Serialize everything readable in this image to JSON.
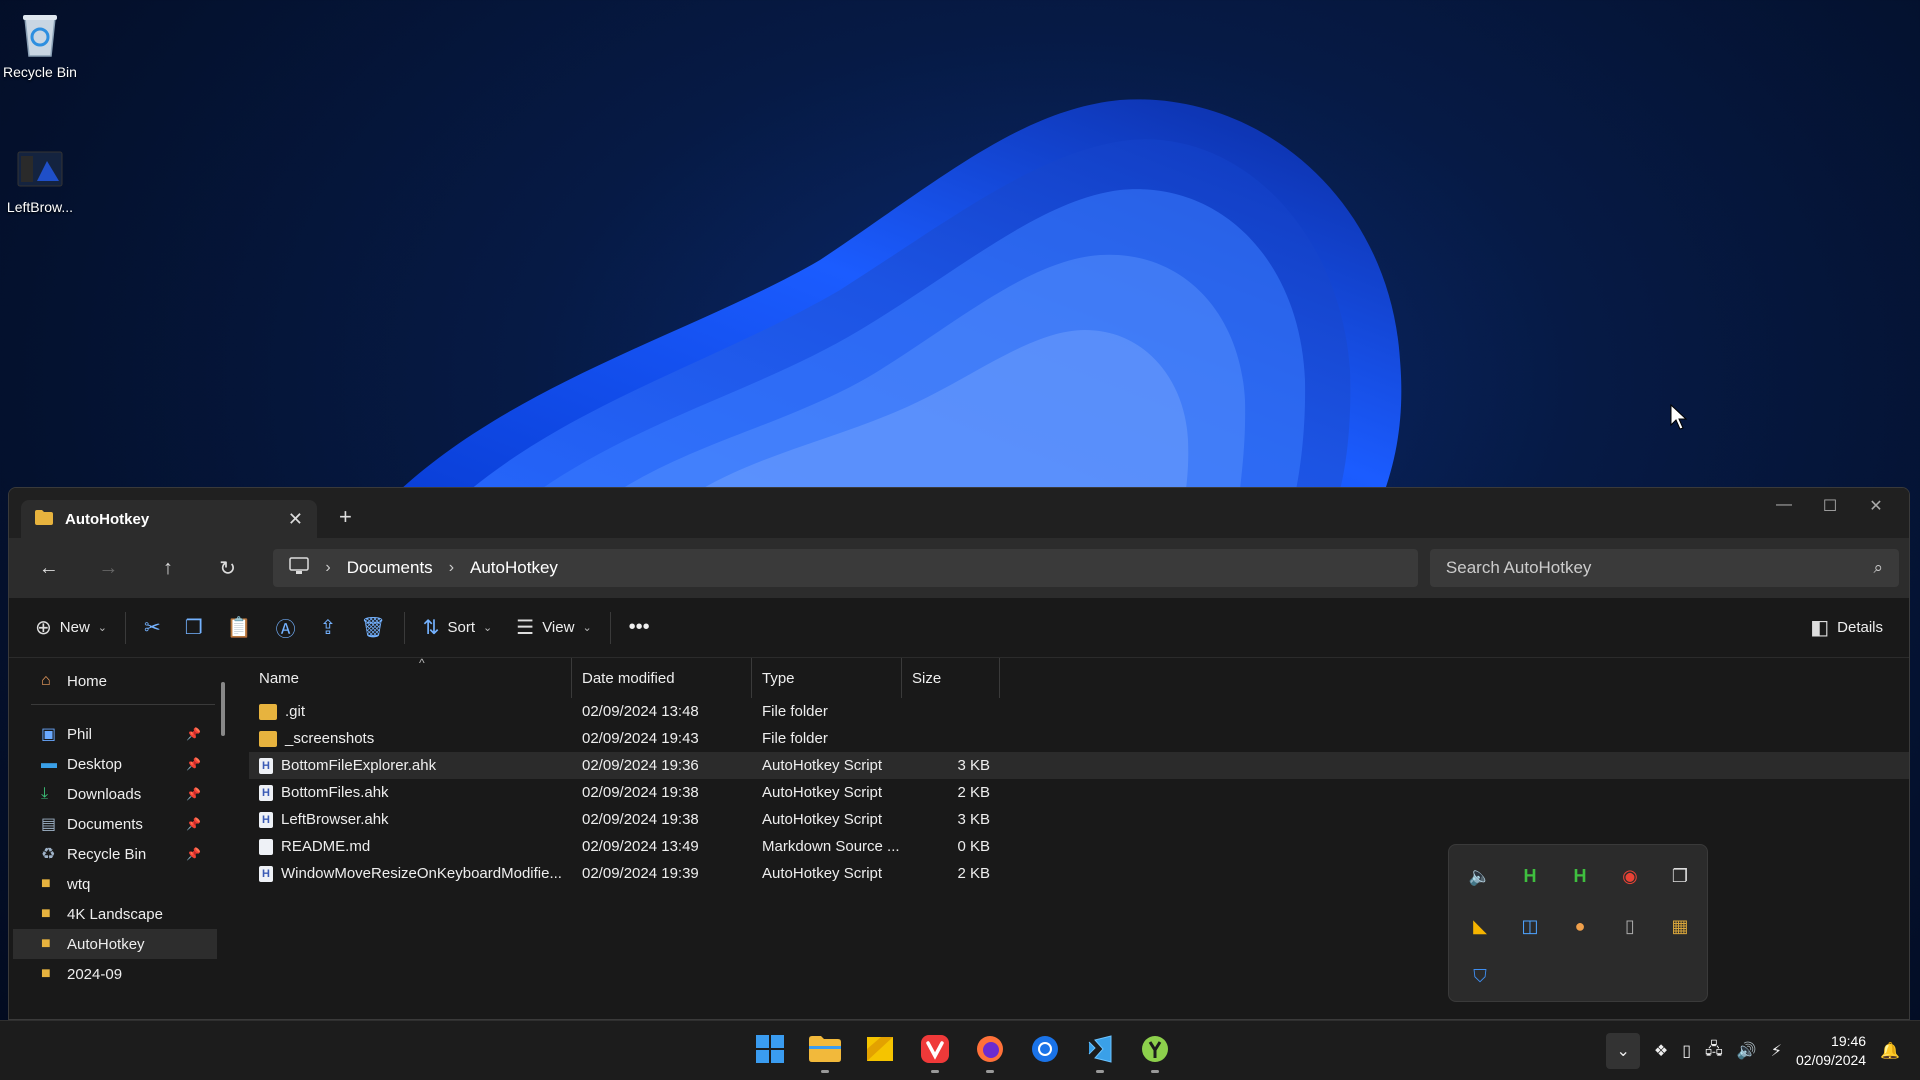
{
  "desktop": {
    "icons": [
      {
        "label": "Recycle Bin",
        "icon": "recycle-bin-icon"
      },
      {
        "label": "LeftBrow...",
        "icon": "shortcut-icon"
      }
    ]
  },
  "window": {
    "tab_title": "AutoHotkey",
    "address": [
      "Documents",
      "AutoHotkey"
    ],
    "search_placeholder": "Search AutoHotkey"
  },
  "toolbar": {
    "new_label": "New",
    "sort_label": "Sort",
    "view_label": "View",
    "details_label": "Details"
  },
  "navpane": {
    "home": "Home",
    "pinned": [
      "Phil",
      "Desktop",
      "Downloads",
      "Documents",
      "Recycle Bin"
    ],
    "folders": [
      "wtq",
      "4K Landscape",
      "AutoHotkey",
      "2024-09"
    ],
    "selected": "AutoHotkey"
  },
  "filelist": {
    "columns": [
      "Name",
      "Date modified",
      "Type",
      "Size"
    ],
    "rows": [
      {
        "name": ".git",
        "date": "02/09/2024 13:48",
        "type": "File folder",
        "size": "",
        "kind": "folder"
      },
      {
        "name": "_screenshots",
        "date": "02/09/2024 19:43",
        "type": "File folder",
        "size": "",
        "kind": "folder"
      },
      {
        "name": "BottomFileExplorer.ahk",
        "date": "02/09/2024 19:36",
        "type": "AutoHotkey Script",
        "size": "3 KB",
        "kind": "ahk"
      },
      {
        "name": "BottomFiles.ahk",
        "date": "02/09/2024 19:38",
        "type": "AutoHotkey Script",
        "size": "2 KB",
        "kind": "ahk"
      },
      {
        "name": "LeftBrowser.ahk",
        "date": "02/09/2024 19:38",
        "type": "AutoHotkey Script",
        "size": "3 KB",
        "kind": "ahk"
      },
      {
        "name": "README.md",
        "date": "02/09/2024 13:49",
        "type": "Markdown Source ...",
        "size": "0 KB",
        "kind": "md"
      },
      {
        "name": "WindowMoveResizeOnKeyboardModifie...",
        "date": "02/09/2024 19:39",
        "type": "AutoHotkey Script",
        "size": "2 KB",
        "kind": "ahk"
      }
    ]
  },
  "taskbar": {
    "time": "19:46",
    "date": "02/09/2024",
    "apps": [
      "start-icon",
      "file-explorer-icon",
      "sticky-notes-icon",
      "vivaldi-icon",
      "firefox-icon",
      "chrome-icon",
      "vscode-icon",
      "yuzu-icon"
    ]
  },
  "colors": {
    "accent": "#74b2ff",
    "folder": "#e7b33e",
    "window_bg": "#191919"
  }
}
